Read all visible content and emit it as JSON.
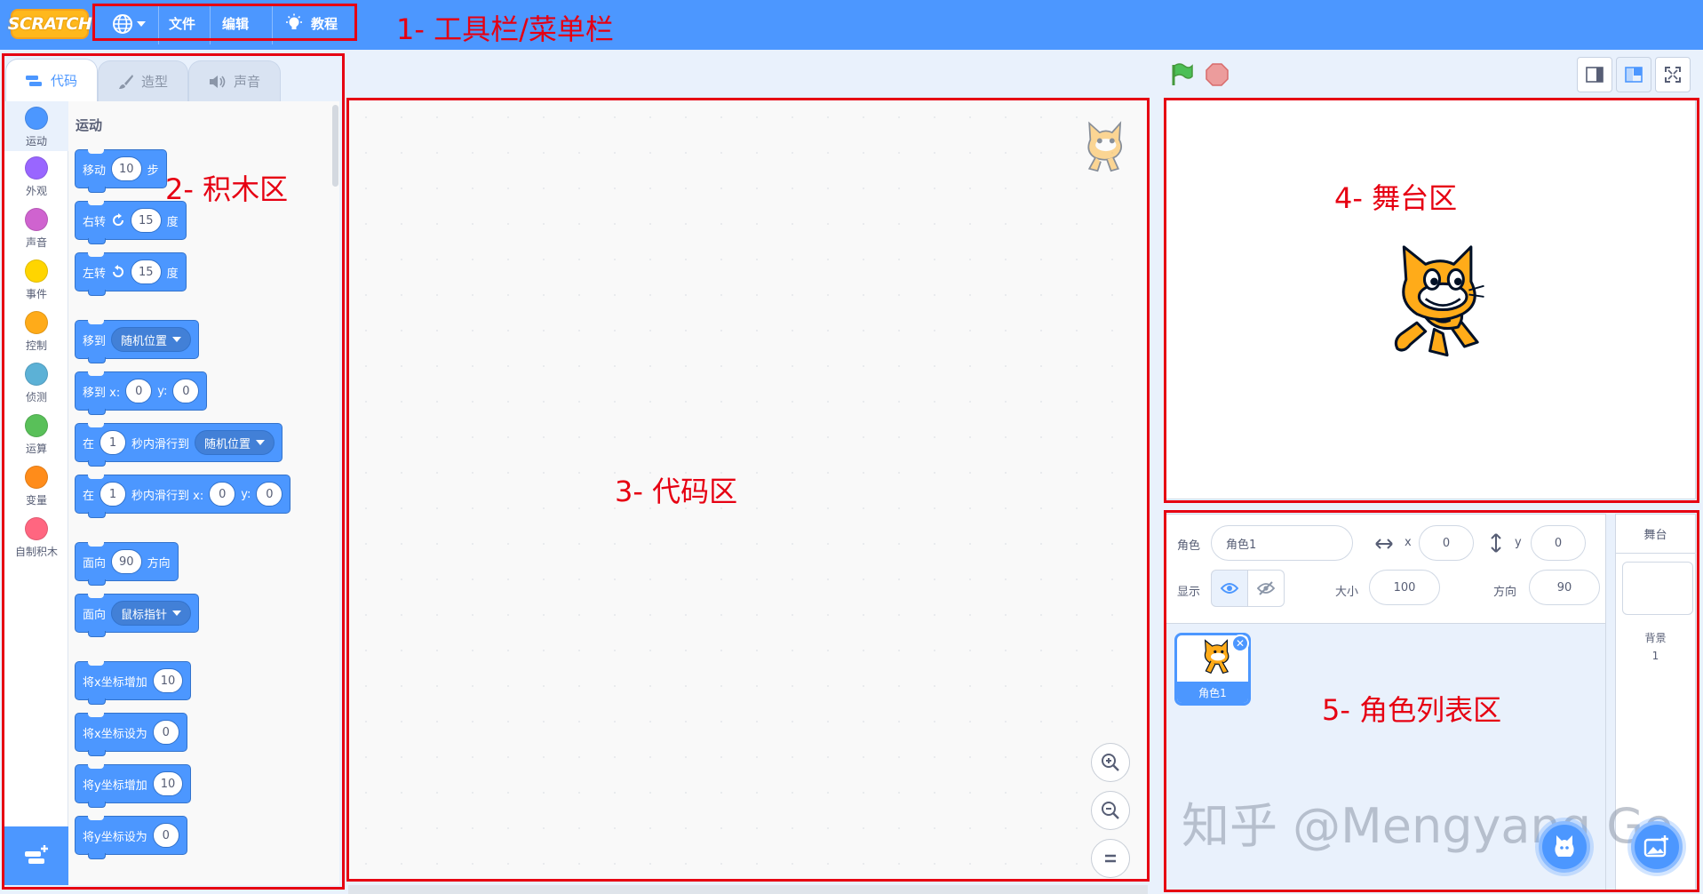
{
  "menu": {
    "logo": "SCRATCH",
    "file": "文件",
    "edit": "编辑",
    "tutorials": "教程"
  },
  "tabs": [
    "代码",
    "造型",
    "声音"
  ],
  "categories": [
    {
      "label": "运动",
      "color": "#4c97ff"
    },
    {
      "label": "外观",
      "color": "#9966ff"
    },
    {
      "label": "声音",
      "color": "#cf63cf"
    },
    {
      "label": "事件",
      "color": "#ffd500"
    },
    {
      "label": "控制",
      "color": "#ffab19"
    },
    {
      "label": "侦测",
      "color": "#5cb1d6"
    },
    {
      "label": "运算",
      "color": "#59c059"
    },
    {
      "label": "变量",
      "color": "#ff8c1a"
    },
    {
      "label": "自制积木",
      "color": "#ff6680"
    }
  ],
  "palette": {
    "title": "运动",
    "move": {
      "a": "移动",
      "n": "10",
      "b": "步"
    },
    "turn_right": {
      "a": "右转",
      "n": "15",
      "b": "度"
    },
    "turn_left": {
      "a": "左转",
      "n": "15",
      "b": "度"
    },
    "goto": {
      "a": "移到",
      "d": "随机位置"
    },
    "goto_xy": {
      "a": "移到 x:",
      "x": "0",
      "b": "y:",
      "y": "0"
    },
    "glide": {
      "a": "在",
      "n": "1",
      "b": "秒内滑行到",
      "d": "随机位置"
    },
    "glide_xy": {
      "a": "在",
      "n": "1",
      "b": "秒内滑行到 x:",
      "x": "0",
      "c": "y:",
      "y": "0"
    },
    "point_dir": {
      "a": "面向",
      "n": "90",
      "b": "方向"
    },
    "point_to": {
      "a": "面向",
      "d": "鼠标指针"
    },
    "change_x": {
      "a": "将x坐标增加",
      "n": "10"
    },
    "set_x": {
      "a": "将x坐标设为",
      "n": "0"
    },
    "change_y": {
      "a": "将y坐标增加",
      "n": "10"
    },
    "set_y": {
      "a": "将y坐标设为",
      "n": "0"
    }
  },
  "annotations": {
    "toolbar": "1- 工具栏/菜单栏",
    "blocks": "2- 积木区",
    "code": "3- 代码区",
    "stage": "4- 舞台区",
    "sprites": "5- 角色列表区"
  },
  "sprite_info": {
    "sprite_label": "角色",
    "sprite_name": "角色1",
    "x_label": "x",
    "x": "0",
    "y_label": "y",
    "y": "0",
    "show_label": "显示",
    "size_label": "大小",
    "size": "100",
    "direction_label": "方向",
    "direction": "90"
  },
  "sprite_list": [
    {
      "name": "角色1"
    }
  ],
  "stage_panel": {
    "title": "舞台",
    "backdrop_label": "背景",
    "backdrop_count": "1"
  },
  "watermark": "知乎 @Mengyang Ge"
}
